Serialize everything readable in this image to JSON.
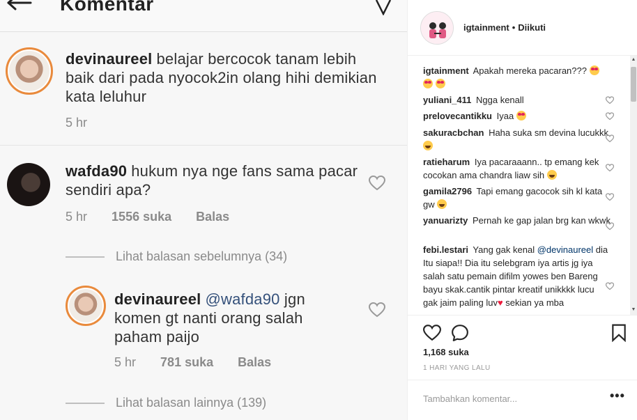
{
  "photo": {
    "header_title": "Komentar",
    "comments": [
      {
        "username": "devinaureel",
        "text": "belajar bercocok tanam lebih baik dari pada nyocok2in olang hihi demikian kata leluhur",
        "time": "5 hr"
      },
      {
        "username": "wafda90",
        "text": "hukum nya nge fans sama pacar sendiri apa?",
        "time": "5 hr",
        "likes": "1556 suka",
        "reply": "Balas"
      }
    ],
    "view_previous": "Lihat balasan sebelumnya (34)",
    "reply_comment": {
      "username": "devinaureel",
      "mention": "@wafda90",
      "text": "jgn komen gt nanti orang salah paham paijo",
      "time": "5 hr",
      "likes": "781 suka",
      "reply": "Balas"
    },
    "view_more": "Lihat balasan lainnya (139)"
  },
  "post": {
    "username": "igtainment",
    "separator": "•",
    "follow_status": "Diikuti",
    "likes": "1,168 suka",
    "time": "1 HARI YANG LALU",
    "add_comment_placeholder": "Tambahkan komentar...",
    "options": "•••"
  },
  "comments": [
    {
      "user": "igtainment",
      "text": "Apakah mereka pacaran???"
    },
    {
      "user": "yuliani_411",
      "text": "Ngga kenall"
    },
    {
      "user": "prelovecantikku",
      "text": "Iyaa"
    },
    {
      "user": "sakuracbchan",
      "text": "Haha suka sm devina lucukkk"
    },
    {
      "user": "ratieharum",
      "text": "Iya pacaraaann.. tp emang kek cocokan ama chandra liaw sih"
    },
    {
      "user": "gamila2796",
      "text": "Tapi emang gacocok sih kl kata gw"
    },
    {
      "user": "yanuarizty",
      "text": "Pernah ke gap jalan brg kan wkwk"
    },
    {
      "user": "febi.lestari",
      "text": "Yang gak kenal",
      "mention": "@devinaureel",
      "text2": "dia Itu siapa!! Dia itu selebgram iya artis jg iya salah satu pemain difilm yowes ben Bareng bayu skak.cantik pintar kreatif unikkkk lucu gak jaim paling luv",
      "text3": "sekian ya mba"
    }
  ],
  "colors": {
    "link": "#003569",
    "ring": "#e98a3c",
    "heart": "#ed1a3b"
  }
}
